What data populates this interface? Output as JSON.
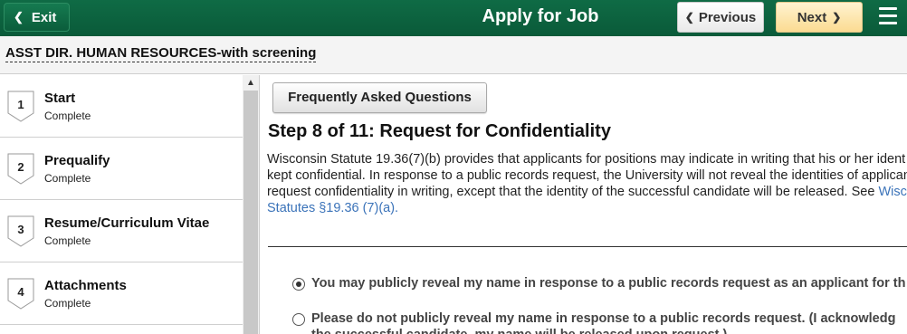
{
  "header": {
    "exit_label": "Exit",
    "title": "Apply for Job",
    "previous_label": "Previous",
    "next_label": "Next",
    "menu_icon": "hamburger-menu-icon"
  },
  "job": {
    "title": "ASST DIR. HUMAN RESOURCES-with screening"
  },
  "sidebar": {
    "steps": [
      {
        "number": "1",
        "name": "Start",
        "status": "Complete"
      },
      {
        "number": "2",
        "name": "Prequalify",
        "status": "Complete"
      },
      {
        "number": "3",
        "name": "Resume/Curriculum Vitae",
        "status": "Complete"
      },
      {
        "number": "4",
        "name": "Attachments",
        "status": "Complete"
      }
    ]
  },
  "main": {
    "faq_label": "Frequently Asked Questions",
    "step_heading": "Step 8 of 11: Request for Confidentiality",
    "statute_lines": [
      "Wisconsin Statute 19.36(7)(b) provides that applicants for positions may indicate in writing that his or her ident",
      "kept confidential. In response to a public records request, the University will not reveal the identities of applican",
      "request confidentiality in writing, except that the identity of the successful candidate will be released. See "
    ],
    "statute_link_line1": "Wisc",
    "statute_link_line2": "Statutes §19.36 (7)(a).",
    "options": [
      {
        "lines": [
          "You may publicly reveal my name in response to a public records request as an applicant for th"
        ],
        "selected": true
      },
      {
        "lines": [
          "Please do not publicly reveal my name in response to a public records request. (I acknowledg",
          "the successful candidate, my name will be released upon request.)"
        ],
        "selected": false
      }
    ]
  },
  "colors": {
    "header_green": "#0f6b45",
    "next_button": "#fbdb92",
    "link_blue": "#3b73b9"
  }
}
